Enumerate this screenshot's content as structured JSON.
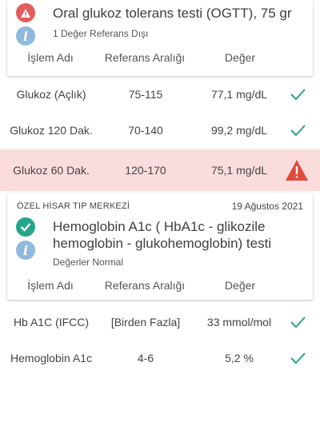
{
  "test1": {
    "title": "Oral glukoz tolerans testi (OGTT), 75 gr",
    "subtitle": "1 Değer Referans Dışı",
    "icons": {
      "status": "warning-icon",
      "info": "info-icon"
    }
  },
  "columns": {
    "name": "İşlem Adı",
    "range": "Referans Aralığı",
    "value": "Değer"
  },
  "rows1": [
    {
      "name": "Glukoz (Açlık)",
      "range": "75-115",
      "value": "77,1 mg/dL",
      "status": "normal"
    },
    {
      "name": "Glukoz 120 Dak.",
      "range": "70-140",
      "value": "99,2 mg/dL",
      "status": "normal"
    },
    {
      "name": "Glukoz 60 Dak.",
      "range": "120-170",
      "value": "75,1 mg/dL",
      "status": "alert"
    }
  ],
  "test2": {
    "organization": "ÖZEL HİSAR TIP MERKEZİ",
    "date": "19 Ağustos 2021",
    "title": "Hemoglobin A1c ( HbA1c - glikozile hemoglobin - glukohemoglobin) testi",
    "subtitle": "Değerler Normal",
    "icons": {
      "status": "check-circle-icon",
      "info": "info-icon"
    }
  },
  "rows2": [
    {
      "name": "Hb A1C (IFCC)",
      "range": "[Birden Fazla]",
      "value": "33 mmol/mol",
      "status": "normal"
    },
    {
      "name": "Hemoglobin A1c",
      "range": "4-6",
      "value": "5,2 %",
      "status": "normal"
    }
  ],
  "colors": {
    "alert_bg": "#fbdcdc",
    "alert_icon": "#e04b3a",
    "check": "#27a58a",
    "info": "#8fb9dd"
  }
}
